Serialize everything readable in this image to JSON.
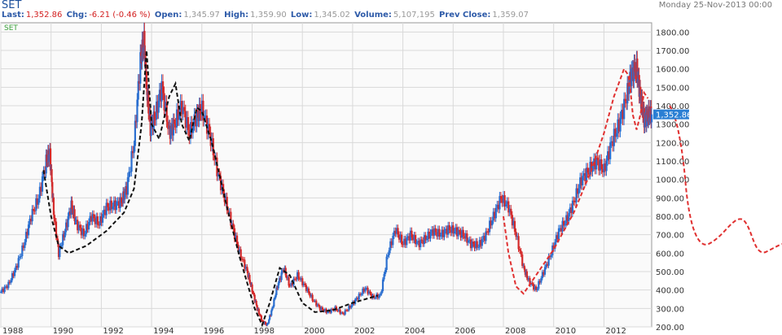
{
  "header": {
    "symbol": "SET",
    "date": "Monday 25-Nov-2013 00:00",
    "last_label": "Last:",
    "last_value": "1,352.86",
    "chg_label": "Chg:",
    "chg_value": "-6.21 (-0.46 %)",
    "open_label": "Open:",
    "open_value": "1,345.97",
    "high_label": "High:",
    "high_value": "1,359.90",
    "low_label": "Low:",
    "low_value": "1,345.02",
    "volume_label": "Volume:",
    "volume_value": "5,107,195",
    "prev_label": "Prev Close:",
    "prev_value": "1,359.07"
  },
  "colors": {
    "up": "#2b6fd0",
    "down": "#d42a2a",
    "grid": "#d9d9d9",
    "black_pattern": "#111111",
    "red_pattern": "#e03030",
    "current_marker": "#2a7fd4"
  },
  "chart_data": {
    "type": "candlestick",
    "legend": "SET",
    "ylim": [
      200,
      1850
    ],
    "xlim": [
      1988,
      2013.9
    ],
    "y_ticks": [
      "200.00",
      "300.00",
      "400.00",
      "500.00",
      "600.00",
      "700.00",
      "800.00",
      "900.00",
      "1000.00",
      "1100.00",
      "1200.00",
      "1300.00",
      "1400.00",
      "1500.00",
      "1600.00",
      "1700.00",
      "1800.00"
    ],
    "x_ticks": [
      "1988",
      "1990",
      "1992",
      "1994",
      "1996",
      "1998",
      "2000",
      "2002",
      "2004",
      "2006",
      "2008",
      "2010",
      "2012"
    ],
    "current_label": "1,352.86",
    "current_value": 1352.86,
    "series": {
      "x": [
        1988.0,
        1988.3,
        1988.6,
        1988.9,
        1989.2,
        1989.5,
        1989.8,
        1989.95,
        1990.1,
        1990.3,
        1990.55,
        1990.8,
        1991.0,
        1991.3,
        1991.6,
        1991.9,
        1992.2,
        1992.5,
        1992.8,
        1993.0,
        1993.3,
        1993.55,
        1993.7,
        1993.8,
        1993.95,
        1994.15,
        1994.4,
        1994.7,
        1994.9,
        1995.2,
        1995.5,
        1995.8,
        1996.0,
        1996.3,
        1996.6,
        1996.9,
        1997.2,
        1997.5,
        1997.8,
        1998.0,
        1998.2,
        1998.4,
        1998.6,
        1998.8,
        1999.0,
        1999.25,
        1999.5,
        1999.8,
        2000.1,
        2000.4,
        2000.7,
        2001.0,
        2001.3,
        2001.6,
        2001.9,
        2002.2,
        2002.5,
        2002.8,
        2003.1,
        2003.4,
        2003.7,
        2004.0,
        2004.3,
        2004.6,
        2004.9,
        2005.2,
        2005.5,
        2005.8,
        2006.1,
        2006.4,
        2006.7,
        2007.0,
        2007.3,
        2007.6,
        2007.9,
        2008.2,
        2008.5,
        2008.8,
        2009.0,
        2009.3,
        2009.6,
        2009.9,
        2010.2,
        2010.5,
        2010.8,
        2011.1,
        2011.4,
        2011.7,
        2012.0,
        2012.3,
        2012.6,
        2012.9,
        2013.1,
        2013.3,
        2013.45,
        2013.6,
        2013.75,
        2013.9
      ],
      "close": [
        390,
        430,
        520,
        640,
        800,
        900,
        1100,
        1140,
        820,
        600,
        720,
        860,
        760,
        700,
        800,
        760,
        850,
        860,
        880,
        950,
        1200,
        1650,
        1750,
        1500,
        1280,
        1350,
        1500,
        1250,
        1300,
        1400,
        1250,
        1350,
        1380,
        1250,
        1050,
        900,
        750,
        600,
        500,
        400,
        300,
        230,
        210,
        300,
        420,
        520,
        420,
        480,
        420,
        350,
        300,
        280,
        300,
        270,
        310,
        360,
        410,
        360,
        370,
        600,
        730,
        650,
        700,
        650,
        680,
        720,
        700,
        730,
        720,
        700,
        650,
        640,
        700,
        800,
        900,
        850,
        700,
        520,
        450,
        400,
        500,
        600,
        720,
        780,
        880,
        1000,
        1050,
        1100,
        1050,
        1200,
        1300,
        1450,
        1580,
        1600,
        1450,
        1320,
        1350,
        1352.86
      ]
    },
    "notes": "Black and red dashed hand-drawn trend patterns overlay the series."
  }
}
